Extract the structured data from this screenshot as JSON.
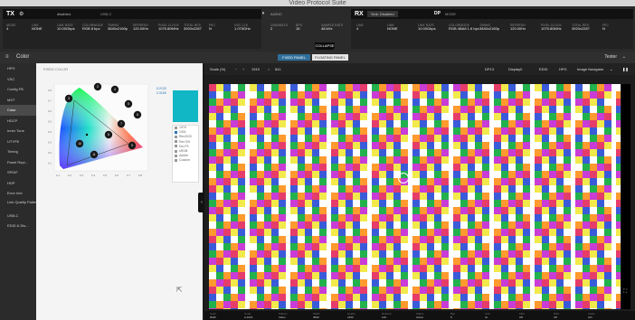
{
  "window": {
    "title": "Video Protocol Suite"
  },
  "tx": {
    "tag": "TX",
    "state": "disabled.",
    "flag": "USB-C",
    "fields": [
      {
        "label": "MODE",
        "value": "4"
      },
      {
        "label": "LINK",
        "value": "NONE"
      },
      {
        "label": "LINK RATE",
        "value": "10.00Gbps"
      },
      {
        "label": "COLORMODE",
        "value": "RGB 8 bpc"
      },
      {
        "label": "TIMING",
        "value": "3840x2160p"
      },
      {
        "label": "REFRESH",
        "value": "120.00Hz"
      },
      {
        "label": "PIXEL CLOCK",
        "value": "1075.80MHz"
      },
      {
        "label": "TOTAL RES",
        "value": "3920x2287"
      },
      {
        "label": "FEC",
        "value": "N"
      },
      {
        "label": "DSC CLK",
        "value": "1.075GHz"
      }
    ],
    "audio": {
      "label": "AUDIO",
      "fields": [
        {
          "label": "CHANNELS",
          "value": "2"
        },
        {
          "label": "BPS",
          "value": "16"
        },
        {
          "label": "SAMPLE RATE",
          "value": "48 kHz"
        }
      ]
    }
  },
  "rx": {
    "tag": "RX",
    "source": "Sink: Disabled",
    "dp_tag": "DP",
    "dp_sub": "MODE",
    "fields": [
      {
        "label": "LINK",
        "value": "4"
      },
      {
        "label": "LINK",
        "value": "NONE"
      },
      {
        "label": "LINK RATE",
        "value": "10.00Gbps"
      },
      {
        "label": "COLORMODE",
        "value": "RGB 4BA8 1.6 bpc"
      },
      {
        "label": "TIMING",
        "value": "3840x2160p"
      },
      {
        "label": "REFRESH",
        "value": "120.00Hz"
      },
      {
        "label": "PIXEL CLOCK",
        "value": "1075.80MHz"
      },
      {
        "label": "TOTAL RES",
        "value": "3920x2287"
      },
      {
        "label": "FEC",
        "value": "N"
      }
    ],
    "collapse_label": "COLLAPSE"
  },
  "toolbar": {
    "title": "Color",
    "seg_fixed": "FIXED PANEL",
    "seg_floating": "FLOATING PANEL",
    "tester": "Tester"
  },
  "sidebar": {
    "items": [
      {
        "label": "HPG"
      },
      {
        "label": "VSC"
      },
      {
        "label": "Config FB"
      },
      {
        "label": "MST"
      },
      {
        "label": "Color",
        "active": true
      },
      {
        "label": "HDCP"
      },
      {
        "label": "Inner Tone"
      },
      {
        "label": "UTYPE"
      },
      {
        "label": "Timing"
      },
      {
        "label": "Panel Repl..."
      },
      {
        "label": "SPDIF"
      },
      {
        "label": "HDP"
      },
      {
        "label": "Error Info"
      },
      {
        "label": "Link Quality Pattern Error"
      },
      {
        "label": "USB-C"
      },
      {
        "label": "EDID & Dis..."
      }
    ]
  },
  "color_panel": {
    "label": "FIXED COLOR",
    "swatch_color": "#11b7c4",
    "swatch_notes": [
      "0.2133",
      "0.3155"
    ],
    "modes": [
      {
        "label": "1976",
        "selected": false
      },
      {
        "label": "1931",
        "selected": true
      },
      {
        "label": "Rec2020",
        "selected": false
      },
      {
        "label": "Rec709",
        "selected": false
      },
      {
        "label": "Dci-P3",
        "selected": false
      },
      {
        "label": "sRGB",
        "selected": false
      },
      {
        "label": "Adobe",
        "selected": false
      },
      {
        "label": "Custom",
        "selected": false
      }
    ],
    "cie_points": [
      "2",
      "3",
      "4",
      "5",
      "6",
      "7",
      "8",
      "9",
      "10",
      "11"
    ],
    "x_ticks": [
      "0.1",
      "0.2",
      "0.3",
      "0.4",
      "0.5",
      "0.6",
      "0.7",
      "0.8"
    ],
    "y_ticks": [
      "0.8",
      "0.7",
      "0.6",
      "0.5",
      "0.4",
      "0.3",
      "0.2",
      "0.1"
    ]
  },
  "canvas": {
    "scale_label": "Scale (%)",
    "scale_value": "1919",
    "scale_unit": "841",
    "tools": [
      "DP13",
      "Display0",
      "EDID",
      "HPG",
      "Image Navigator"
    ],
    "stripe_colors": [
      "#e63c6a",
      "#f2e94a",
      "#3a5bd9",
      "#ffffff",
      "#22b14c",
      "#ff9a2e",
      "#c93cd6"
    ],
    "bottom": [
      {
        "label": "Color",
        "value": "RGB"
      },
      {
        "label": "Code",
        "value": "0-1023"
      },
      {
        "label": "Pattern",
        "value": "Video"
      },
      {
        "label": "Width",
        "value": "3840"
      },
      {
        "label": "Height",
        "value": "2160"
      },
      {
        "label": "Refresh",
        "value": "120"
      },
      {
        "label": "Status",
        "value": "Active"
      },
      {
        "label": "Bpc",
        "value": "8"
      },
      {
        "label": "Link",
        "value": "4L"
      },
      {
        "label": "FEC",
        "value": "Off"
      },
      {
        "label": "DSC",
        "value": "Off"
      },
      {
        "label": "Audio",
        "value": "2ch"
      }
    ]
  }
}
